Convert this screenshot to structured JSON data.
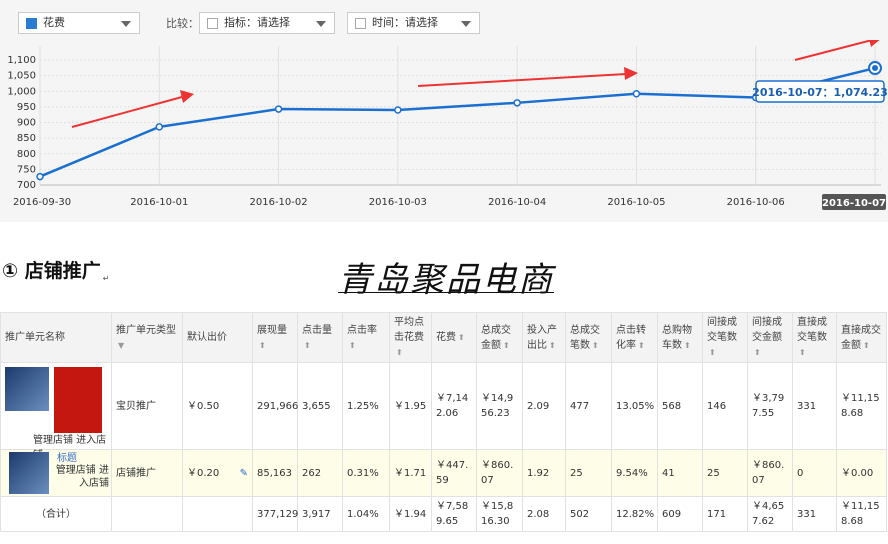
{
  "toolbar": {
    "metric_select": "花费",
    "compare_label": "比较：",
    "indicator_select": "指标：请选择",
    "time_select": "时间：请选择"
  },
  "chart_data": {
    "type": "line",
    "x": [
      "2016-09-30",
      "2016-10-01",
      "2016-10-02",
      "2016-10-03",
      "2016-10-04",
      "2016-10-05",
      "2016-10-06",
      "2016-10-07"
    ],
    "series": [
      {
        "values": [
          727,
          886,
          943,
          940,
          963,
          992,
          980,
          1074.23
        ],
        "color": "#1a6fd0"
      }
    ],
    "yticks": [
      700,
      750,
      800,
      850,
      900,
      950,
      1000,
      1050,
      1100
    ],
    "ylim": [
      700,
      1100
    ],
    "grid": true,
    "tooltip": "2016-10-07：1,074.23",
    "highlighted_x": "2016-10-07"
  },
  "section": {
    "index": "①",
    "title": "店铺推广",
    "mark": "↵"
  },
  "watermark": "青岛聚品电商",
  "table": {
    "headers": [
      "推广单元名称",
      "推广单元类型",
      "默认出价",
      "展现量",
      "点击量",
      "点击率",
      "平均点击花费",
      "花费",
      "总成交金额",
      "投入产出比",
      "总成交笔数",
      "点击转化率",
      "总购物车数",
      "间接成交笔数",
      "间接成交金额",
      "直接成交笔数",
      "直接成交金额"
    ],
    "row1": {
      "actions": "管理店铺 进入店铺",
      "type": "宝贝推广",
      "bid": "￥0.50",
      "impr": "291,966",
      "clicks": "3,655",
      "ctr": "1.25%",
      "cpc": "￥1.95",
      "cost": "￥7,142.06",
      "gmv": "￥14,956.23",
      "roi": "2.09",
      "orders": "477",
      "cvr": "13.05%",
      "cart": "568",
      "ind_orders": "146",
      "ind_gmv": "￥3,797.55",
      "dir_orders": "331",
      "dir_gmv": "￥11,158.68"
    },
    "row2": {
      "name": "标题",
      "actions": "管理店铺 进入店铺",
      "type": "店铺推广",
      "bid": "￥0.20",
      "impr": "85,163",
      "clicks": "262",
      "ctr": "0.31%",
      "cpc": "￥1.71",
      "cost": "￥447.59",
      "gmv": "￥860.07",
      "roi": "1.92",
      "orders": "25",
      "cvr": "9.54%",
      "cart": "41",
      "ind_orders": "25",
      "ind_gmv": "￥860.07",
      "dir_orders": "0",
      "dir_gmv": "￥0.00"
    },
    "total": {
      "label": "（合计）",
      "impr": "377,129",
      "clicks": "3,917",
      "ctr": "1.04%",
      "cpc": "￥1.94",
      "cost": "￥7,589.65",
      "gmv": "￥15,816.30",
      "roi": "2.08",
      "orders": "502",
      "cvr": "12.82%",
      "cart": "609",
      "ind_orders": "171",
      "ind_gmv": "￥4,657.62",
      "dir_orders": "331",
      "dir_gmv": "￥11,158.68"
    }
  }
}
